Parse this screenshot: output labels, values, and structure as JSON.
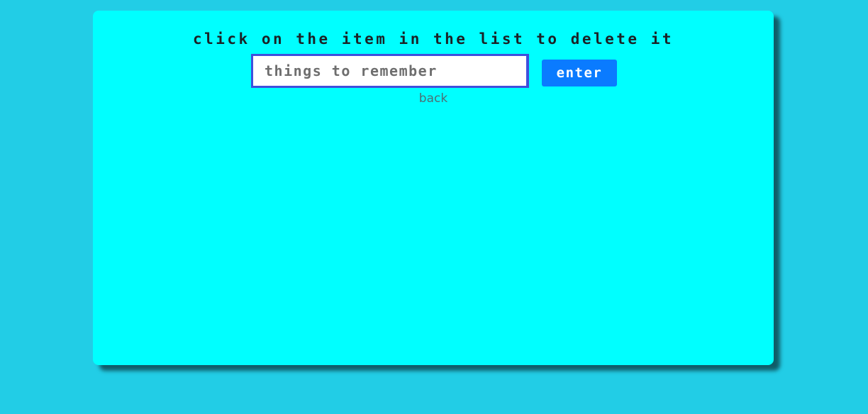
{
  "heading": "click on the item in the list to delete it",
  "entry": {
    "value": "",
    "placeholder": "things to remember"
  },
  "enter_button_label": "enter",
  "back_link_label": "back",
  "items": [],
  "colors": {
    "page_background": "#22cde6",
    "card_background": "#00ffff",
    "input_border": "#3f4fdc",
    "button_background": "#0a7bff",
    "button_text": "#ffffff",
    "heading_text": "#1b2226",
    "link_text": "#4b6f75"
  }
}
